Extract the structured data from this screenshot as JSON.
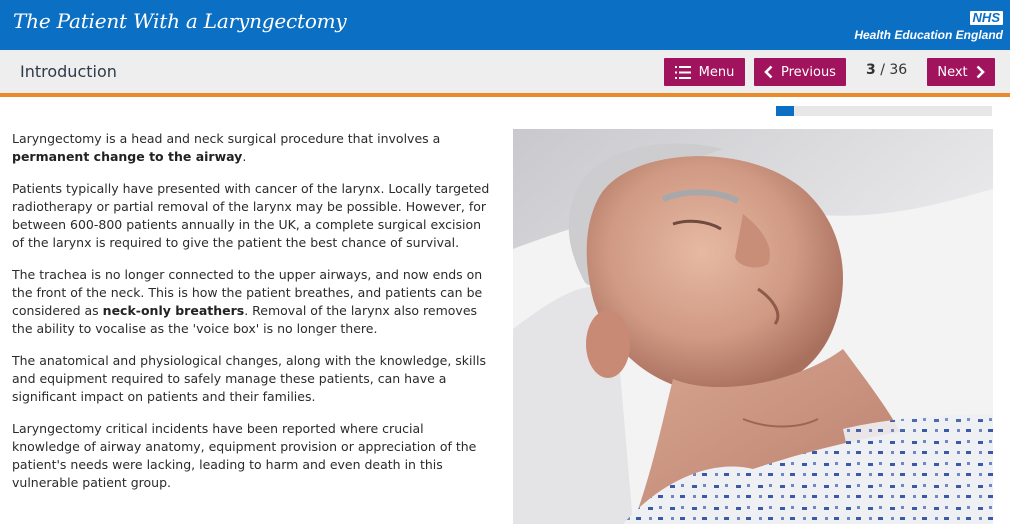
{
  "header": {
    "course_title": "The Patient With a Laryngectomy",
    "logo_text": "NHS",
    "org_name": "Health Education England"
  },
  "nav": {
    "page_title": "Introduction",
    "menu_label": "Menu",
    "previous_label": "Previous",
    "next_label": "Next",
    "current_page": "3",
    "total_pages": "/ 36",
    "progress_fraction": 0.083
  },
  "content": {
    "p1_text": "Laryngectomy is a head and neck surgical procedure that involves a ",
    "p1_bold": "permanent change to the airway",
    "p1_end": ".",
    "p2": "Patients typically have presented with cancer of the larynx. Locally targeted radiotherapy or partial removal of the larynx may be possible. However, for between 600-800 patients annually in the UK, a complete surgical excision of the larynx is required to give the patient the best chance of survival.",
    "p3_text": "The trachea is no longer connected to the upper airways, and now ends on the front of the neck. This is how the patient breathes, and patients can be considered as ",
    "p3_bold": "neck-only breathers",
    "p3_end": ". Removal of the larynx also removes the ability to vocalise as the 'voice box' is no longer there.",
    "p4": "The anatomical and physiological changes, along with the knowledge, skills and equipment required to safely manage these patients, can have a significant impact on patients and their families.",
    "p5": "Laryngectomy critical incidents have been reported where crucial knowledge of airway anatomy, equipment provision or appreciation of the patient's needs were lacking, leading to harm and even death in this vulnerable patient group."
  },
  "colors": {
    "header_blue": "#0b6fc4",
    "button_magenta": "#a1135d",
    "accent_orange": "#ea8b2b"
  }
}
